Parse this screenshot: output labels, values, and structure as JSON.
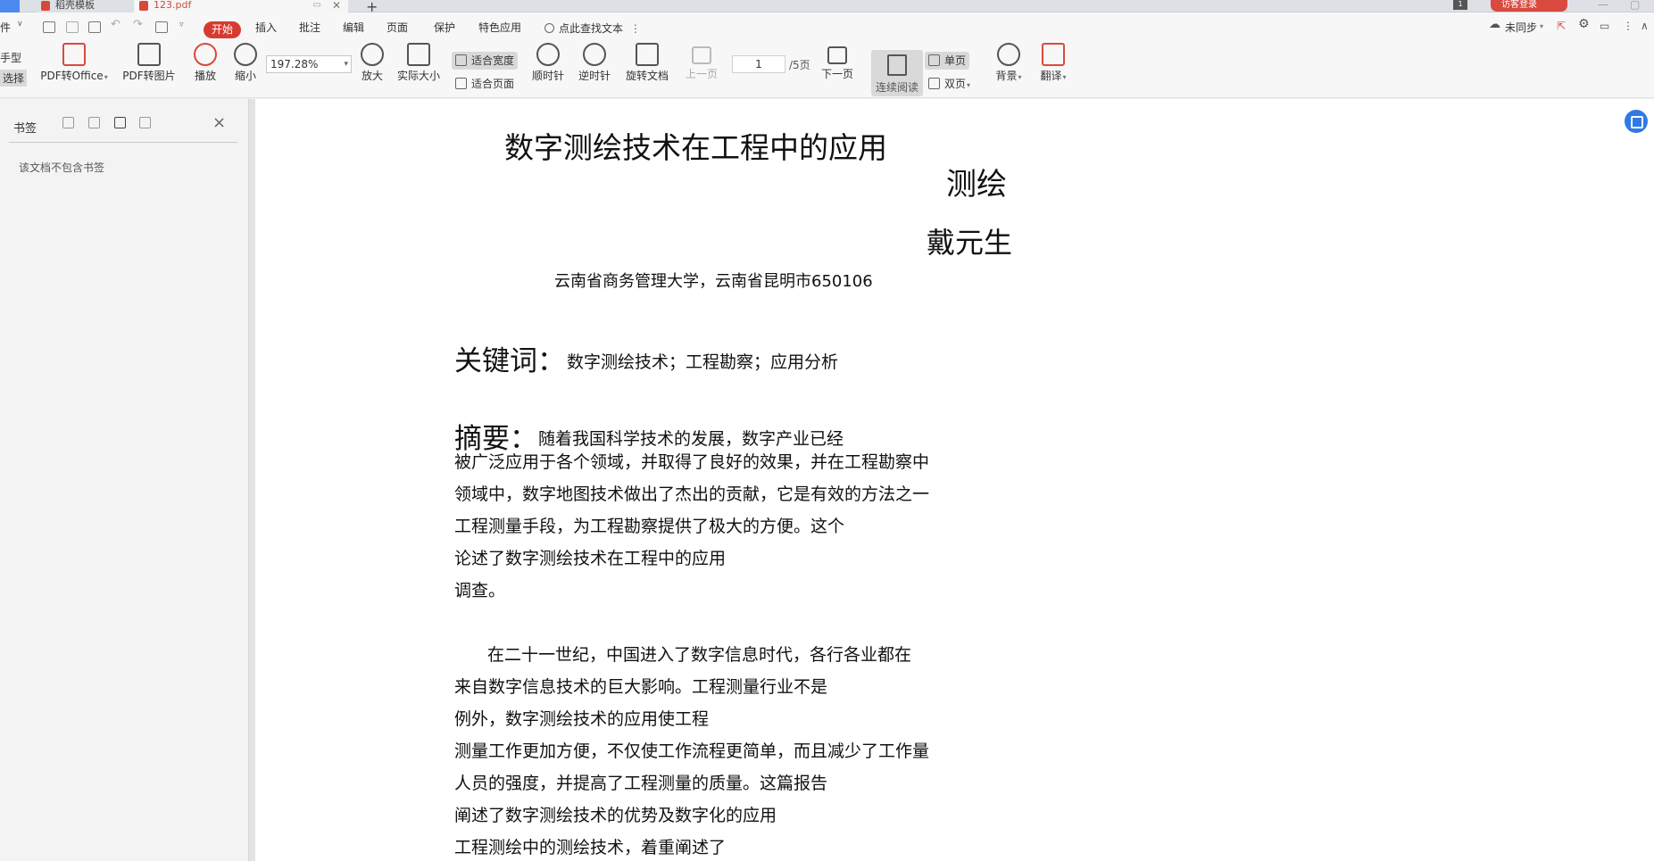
{
  "titlebar": {
    "tab1": "稻壳模板",
    "tab2": "123.pdf",
    "plus": "+",
    "login": "访客登录",
    "square_label": "1"
  },
  "menubar": {
    "file_frag": "件",
    "start": "开始",
    "items": [
      "插入",
      "批注",
      "编辑",
      "页面",
      "保护",
      "特色应用"
    ],
    "search": "点此查找文本",
    "sync": "未同步"
  },
  "toolbar": {
    "left_frag_1": "手型",
    "left_frag_2": "选择",
    "pdf_office": "PDF转Office",
    "pdf_image": "PDF转图片",
    "play": "播放",
    "zoom_out": "缩小",
    "zoom_value": "197.28%",
    "zoom_in": "放大",
    "actual_size": "实际大小",
    "fit_width": "适合宽度",
    "fit_page": "适合页面",
    "clockwise": "顺时针",
    "counter_clockwise": "逆时针",
    "rotate_doc": "旋转文档",
    "prev_page": "上一页",
    "page_value": "1",
    "page_total": "/5页",
    "next_page": "下一页",
    "continuous": "连续阅读",
    "single_page": "单页",
    "double_page": "双页",
    "background": "背景",
    "translate": "翻译"
  },
  "leftpanel": {
    "title": "书签",
    "empty": "该文档不包含书签"
  },
  "document": {
    "title": "数字测绘技术在工程中的应用",
    "subtitle": "测绘",
    "author": "戴元生",
    "affiliation": "云南省商务管理大学，云南省昆明市650106",
    "keywords_label": "关键词：",
    "keywords": "数字测绘技术；工程勘察；应用分析",
    "abstract_label": "摘要：",
    "abstract_first": "随着我国科学技术的发展，数字产业已经",
    "abstract_lines": [
      "被广泛应用于各个领域，并取得了良好的效果，并在工程勘察中",
      "领域中，数字地图技术做出了杰出的贡献，它是有效的方法之一",
      "工程测量手段，为工程勘察提供了极大的方便。这个",
      "论述了数字测绘技术在工程中的应用",
      "调查。"
    ],
    "body_lines": [
      "在二十一世纪，中国进入了数字信息时代，各行各业都在",
      "来自数字信息技术的巨大影响。工程测量行业不是",
      "例外，数字测绘技术的应用使工程",
      "测量工作更加方便，不仅使工作流程更简单，而且减少了工作量",
      "人员的强度，并提高了工程测量的质量。这篇报告",
      "阐述了数字测绘技术的优势及数字化的应用",
      "工程测绘中的测绘技术，着重阐述了"
    ]
  }
}
